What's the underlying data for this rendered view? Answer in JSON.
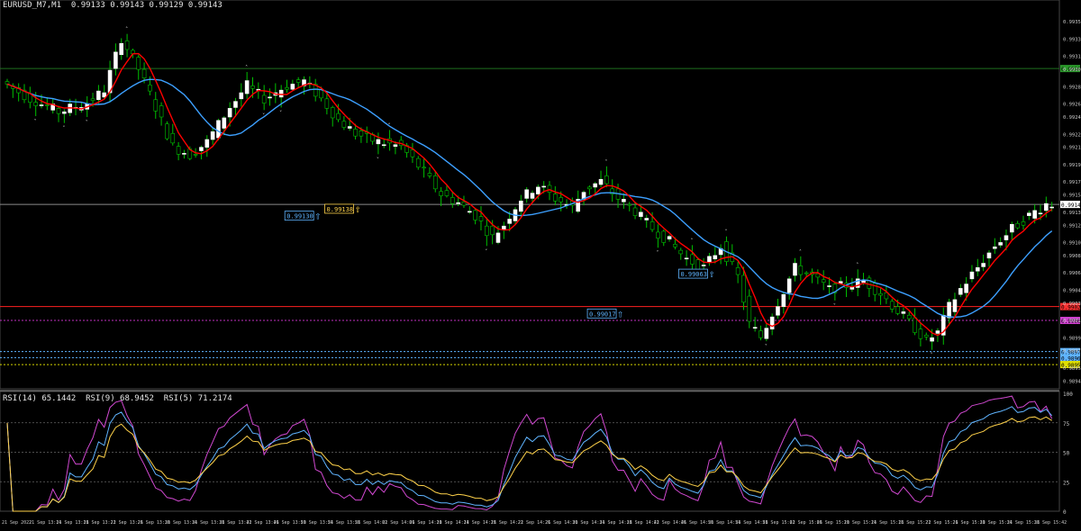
{
  "symbol_header": "EURUSD_M7,M1  0.99133 0.99143 0.99129 0.99143",
  "rsi_header": "RSI(14) 65.1442  RSI(9) 68.9452  RSI(5) 71.2174",
  "colors": {
    "background": "#000000",
    "bull_candle": "#ffffff",
    "bear_candle": "#000000",
    "wick": "#00c000",
    "ma_fast": "#ff0000",
    "ma_slow": "#3da0ff",
    "rsi14": "#ffd24a",
    "rsi9": "#5fb4ff",
    "rsi5": "#d048d0",
    "axis_text": "#c8c8c8"
  },
  "price_labels": [
    "0.99355",
    "0.99335",
    "0.99315",
    "0.99300",
    "0.99280",
    "0.99260",
    "0.99245",
    "0.99225",
    "0.99210",
    "0.99190",
    "0.99170",
    "0.99155",
    "0.99135",
    "0.99120",
    "0.99100",
    "0.99085",
    "0.99065",
    "0.99045",
    "0.99030",
    "0.99010",
    "0.98990",
    "0.98975",
    "0.98955",
    "0.98940"
  ],
  "rsi_labels": [
    "100",
    "75",
    "50",
    "25",
    "0"
  ],
  "time_labels": [
    "21 Sep 2022",
    "21 Sep 13:14",
    "21 Sep 13:18",
    "21 Sep 13:22",
    "21 Sep 13:26",
    "21 Sep 13:30",
    "21 Sep 13:34",
    "21 Sep 13:38",
    "21 Sep 13:42",
    "21 Sep 13:46",
    "21 Sep 13:50",
    "21 Sep 13:54",
    "21 Sep 13:58",
    "21 Sep 14:02",
    "21 Sep 14:06",
    "21 Sep 14:10",
    "21 Sep 14:14",
    "21 Sep 14:18",
    "21 Sep 14:22",
    "21 Sep 14:26",
    "21 Sep 14:30",
    "21 Sep 14:34",
    "21 Sep 14:38",
    "21 Sep 14:42",
    "21 Sep 14:46",
    "21 Sep 14:50",
    "21 Sep 14:54",
    "21 Sep 14:58",
    "21 Sep 15:02",
    "21 Sep 15:06",
    "21 Sep 15:10",
    "21 Sep 15:14",
    "21 Sep 15:18",
    "21 Sep 15:22",
    "21 Sep 15:26",
    "21 Sep 15:30",
    "21 Sep 15:34",
    "21 Sep 15:38",
    "21 Sep 15:42"
  ],
  "annotations": [
    {
      "text": "0.99130",
      "price": 0.9913,
      "index": 54,
      "color": "#5fb4ff"
    },
    {
      "text": "0.99138",
      "price": 0.99138,
      "index": 61,
      "color": "#ffd24a"
    },
    {
      "text": "0.99017",
      "price": 0.99017,
      "index": 107,
      "color": "#5fb4ff"
    },
    {
      "text": "0.99063",
      "price": 0.99063,
      "index": 123,
      "color": "#5fb4ff"
    }
  ],
  "chart_data": {
    "type": "candlestick",
    "price_axis": {
      "min": 0.9893,
      "max": 0.99375
    },
    "rsi_axis": {
      "min": 0,
      "max": 100
    },
    "levels": [
      {
        "price": 0.993,
        "color": "#1f6f1f",
        "style": "solid",
        "tag": "0.99300",
        "tag_color": "#2a9a2a"
      },
      {
        "price": 0.99143,
        "color": "#8a8a8a",
        "style": "solid",
        "tag": "0.99143",
        "tag_color": "#ffffff"
      },
      {
        "price": 0.99025,
        "color": "#ff2020",
        "style": "solid",
        "tag": "0.99025",
        "tag_color": "#ff3030"
      },
      {
        "price": 0.99009,
        "color": "#c030c0",
        "style": "dotted",
        "tag": "0.99009",
        "tag_color": "#d040d0"
      },
      {
        "price": 0.98973,
        "color": "#5fb4ff",
        "style": "dotted",
        "tag": "0.98973",
        "tag_color": "#5fb4ff"
      },
      {
        "price": 0.98966,
        "color": "#5fb4ff",
        "style": "dotted",
        "tag": "0.98966",
        "tag_color": "#5fb4ff"
      },
      {
        "price": 0.98958,
        "color": "#d4d400",
        "style": "dotted",
        "tag": "0.98958",
        "tag_color": "#e0e000"
      }
    ],
    "rsi_levels": [
      75,
      50,
      25
    ],
    "candles": [],
    "rsi14": [],
    "rsi9": [],
    "rsi5": []
  }
}
